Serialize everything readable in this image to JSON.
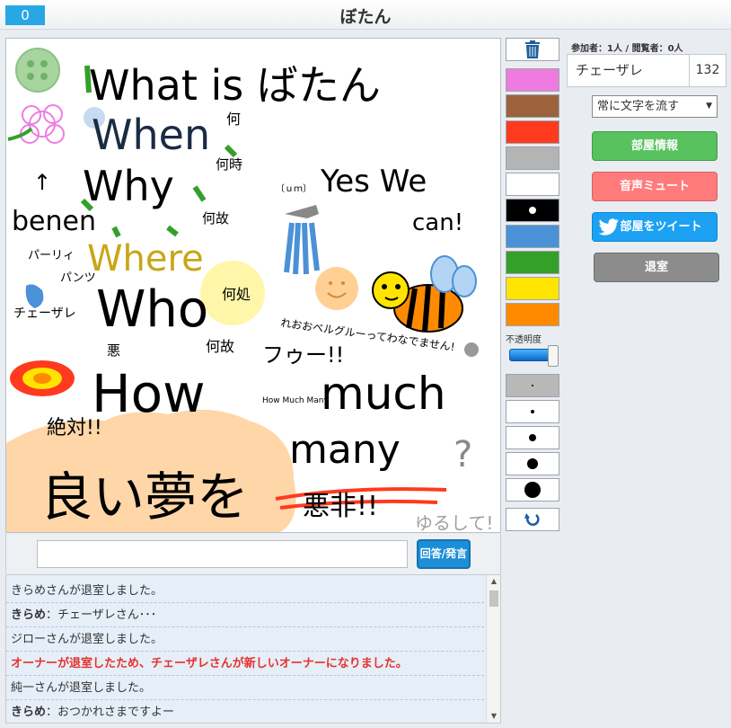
{
  "header": {
    "score": "0",
    "title": "ぼたん"
  },
  "canvas": {
    "texts": {
      "what_is": "What is ばたん",
      "when": "When",
      "why": "Why",
      "where": "Where",
      "who": "Who",
      "how": "How",
      "much": "much",
      "many": "many",
      "yes_we": "Yes We",
      "can": "can!",
      "nani": "何",
      "nanji": "何時",
      "naze1": "何故",
      "naze2": "何故",
      "doko": "何処",
      "naze3": "何故",
      "benen": "benen",
      "hoshii": "パンツ",
      "chuuzare": "チェーザレ",
      "bad": "悪",
      "arrow_up": "↑",
      "uhm": "〔ｕｍ〕",
      "sumimasen": "れおおベルグルーってわなでません!",
      "fu": "フゥー!!",
      "how_much_many": "How Much Many",
      "zettai": "絶対!!",
      "yoiyume": "良い夢を",
      "ashi": "悪非!!",
      "yurushite": "ゆるして!",
      "question": "?",
      "hira": "パーリィ"
    }
  },
  "answer": {
    "placeholder": "",
    "button_label": "回答/発言"
  },
  "chat": [
    {
      "user": "",
      "text": "きらめさんが退室しました。",
      "alert": false
    },
    {
      "user": "きらめ",
      "text": "：チェーザレさん･･･",
      "alert": false
    },
    {
      "user": "",
      "text": "ジローさんが退室しました。",
      "alert": false
    },
    {
      "user": "",
      "text": "オーナーが退室したため、チェーザレさんが新しいオーナーになりました。",
      "alert": true
    },
    {
      "user": "",
      "text": "純一さんが退室しました。",
      "alert": false
    },
    {
      "user": "きらめ",
      "text": "：おつかれさまですよー",
      "alert": false
    }
  ],
  "palette": {
    "colors": [
      "#ee7ce0",
      "#9c623c",
      "#ff3a1e",
      "#b4b4b4",
      "#ffffff",
      "#000000",
      "#4a91d8",
      "#34a02a",
      "#ffe400",
      "#ff8a00"
    ],
    "opacity_label": "不透明度",
    "opacity_value": 0.9,
    "sizes": [
      2,
      4,
      8,
      12,
      18
    ]
  },
  "sidebar": {
    "stats": "参加者：1人 / 閲覧者：0人",
    "player_name": "チェーザレ",
    "player_score": "132",
    "flow_select": "常に文字を流す",
    "room_info": "部屋情報",
    "mute": "音声ミュート",
    "tweet": "部屋をツイート",
    "exit": "退室"
  },
  "colors": {
    "accent": "#27a8e4",
    "room_btn": "#57c25e",
    "mute_btn": "#ff7b7b",
    "tweet_btn": "#1da1f2",
    "exit_btn": "#8c8c8c",
    "alert_text": "#e5322d"
  }
}
